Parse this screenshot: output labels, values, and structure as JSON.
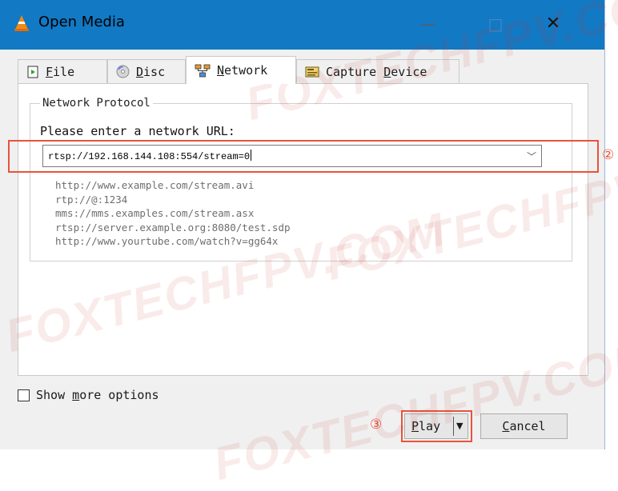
{
  "window": {
    "title": "Open Media",
    "controls": {
      "minimize": "—",
      "maximize": "□",
      "close": "✕"
    }
  },
  "tabs": [
    {
      "prefix": "",
      "mnemonic": "F",
      "rest": "ile",
      "icon": "file-icon"
    },
    {
      "prefix": "",
      "mnemonic": "D",
      "rest": "isc",
      "icon": "disc-icon"
    },
    {
      "prefix": "",
      "mnemonic": "N",
      "rest": "etwork",
      "icon": "network-icon",
      "active": true
    },
    {
      "prefix": "Capture ",
      "mnemonic": "D",
      "rest": "evice",
      "icon": "capture-device-icon"
    }
  ],
  "network": {
    "group_label": "Network Protocol",
    "prompt": "Please enter a network URL:",
    "url_value": "rtsp://192.168.144.108:554/stream=0",
    "examples": [
      "http://www.example.com/stream.avi",
      "rtp://@:1234",
      "mms://mms.examples.com/stream.asx",
      "rtsp://server.example.org:8080/test.sdp",
      "http://www.yourtube.com/watch?v=gg64x"
    ]
  },
  "options": {
    "show_more_prefix": "Show ",
    "show_more_mnemonic": "m",
    "show_more_rest": "ore options",
    "checked": false
  },
  "buttons": {
    "play_mnemonic": "P",
    "play_rest": "lay",
    "cancel_mnemonic": "C",
    "cancel_rest": "ancel"
  },
  "annotations": {
    "marker_url": "②",
    "marker_play": "③"
  },
  "watermark": {
    "text": "FOXTECHFPV.COM"
  },
  "colors": {
    "titlebar": "#1279c4",
    "highlight": "#e8533a",
    "dialog_bg": "#f0f0f0"
  }
}
